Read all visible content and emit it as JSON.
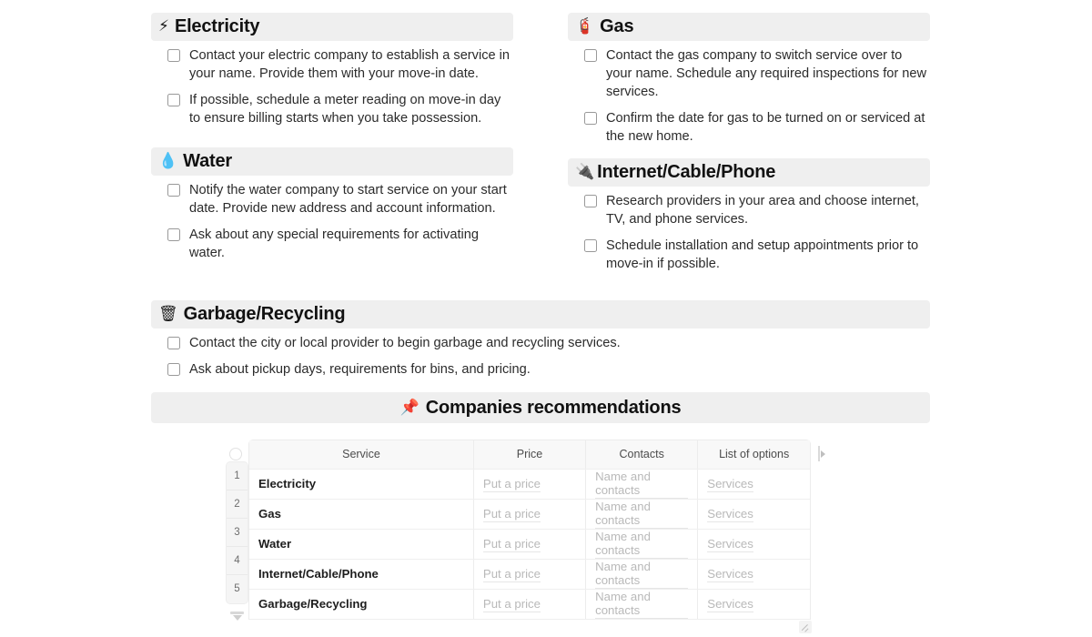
{
  "sections": [
    {
      "id": "electricity",
      "icon": "high-voltage-icon",
      "emoji": "⚡",
      "title": "Electricity",
      "items": [
        "Contact your electric company to establish a service in your name. Provide them with your move-in date.",
        "If possible, schedule a meter reading on move-in day to ensure billing starts when you take possession."
      ]
    },
    {
      "id": "gas",
      "icon": "gas-cylinder-icon",
      "emoji": "🧯",
      "title": "Gas",
      "items": [
        "Contact the gas company to switch service over to your name. Schedule any required inspections for new services.",
        "Confirm the date for gas to be turned on or serviced at the new home."
      ]
    },
    {
      "id": "water",
      "icon": "water-droplet-icon",
      "emoji": "💧",
      "title": "Water",
      "items": [
        "Notify the water company to start service on your start date. Provide new address and account information.",
        "Ask about any special requirements for activating water."
      ]
    },
    {
      "id": "internet",
      "icon": "electric-plug-icon",
      "emoji": "🔌",
      "title": "Internet/Cable/Phone",
      "items": [
        "Research providers in your area and choose internet, TV, and phone services.",
        "Schedule installation and setup appointments prior to move-in if possible."
      ]
    },
    {
      "id": "garbage",
      "icon": "wastebasket-icon",
      "emoji": "🗑",
      "title": "Garbage/Recycling",
      "items": [
        "Contact the city or local provider to begin garbage and recycling services.",
        "Ask about pickup days, requirements for bins, and pricing."
      ]
    }
  ],
  "banner": {
    "icon": "pushpin-icon",
    "emoji": "📌",
    "title": "Companies recommendations"
  },
  "table": {
    "columns": [
      "Service",
      "Price",
      "Contacts",
      "List of options"
    ],
    "row_numbers": [
      "1",
      "2",
      "3",
      "4",
      "5"
    ],
    "placeholders": {
      "price": "Put a price",
      "contacts": "Name and contacts",
      "options": "Services"
    },
    "rows": [
      {
        "num": "1",
        "service": "Electricity",
        "price": "Put a price",
        "contacts": "Name and contacts",
        "options": "Services"
      },
      {
        "num": "2",
        "service": "Gas",
        "price": "Put a price",
        "contacts": "Name and contacts",
        "options": "Services"
      },
      {
        "num": "3",
        "service": "Water",
        "price": "Put a price",
        "contacts": "Name and contacts",
        "options": "Services"
      },
      {
        "num": "4",
        "service": "Internet/Cable/Phone",
        "price": "Put a price",
        "contacts": "Name and contacts",
        "options": "Services"
      },
      {
        "num": "5",
        "service": "Garbage/Recycling",
        "price": "Put a price",
        "contacts": "Name and contacts",
        "options": "Services"
      }
    ]
  },
  "colors": {
    "header_bg": "#efefef",
    "page_bg": "#ffffff",
    "text": "#1b1b1b",
    "placeholder": "#b9b9b9",
    "grid_line": "#ececec",
    "row_number_bg": "#f5f5f5"
  }
}
